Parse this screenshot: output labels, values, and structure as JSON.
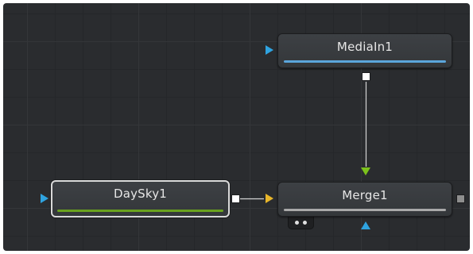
{
  "flow_editor": {
    "nodes": {
      "mediain": {
        "label": "MediaIn1",
        "bar_color": "#5ba6dc",
        "selected": false
      },
      "daysky": {
        "label": "DaySky1",
        "bar_color": "#6aa31e",
        "selected": true
      },
      "merge": {
        "label": "Merge1",
        "bar_color": "#a9a9a9",
        "selected": false
      }
    },
    "connections": [
      {
        "from": "MediaIn1",
        "to": "Merge1",
        "input": "foreground"
      },
      {
        "from": "DaySky1",
        "to": "Merge1",
        "input": "background"
      }
    ],
    "colors": {
      "canvas_background": "#2a2c2f",
      "background_input": "#e8b62a",
      "foreground_input": "#7cc21c",
      "mask_input": "#2fa3e0",
      "output": "#ffffff",
      "merge_output": "#8e8e8e",
      "wire": "#d4d4d4"
    },
    "icons": {
      "input_arrow": "triangle-right-icon",
      "output_port": "square-icon",
      "mask_dots": "two-dots-icon"
    }
  }
}
